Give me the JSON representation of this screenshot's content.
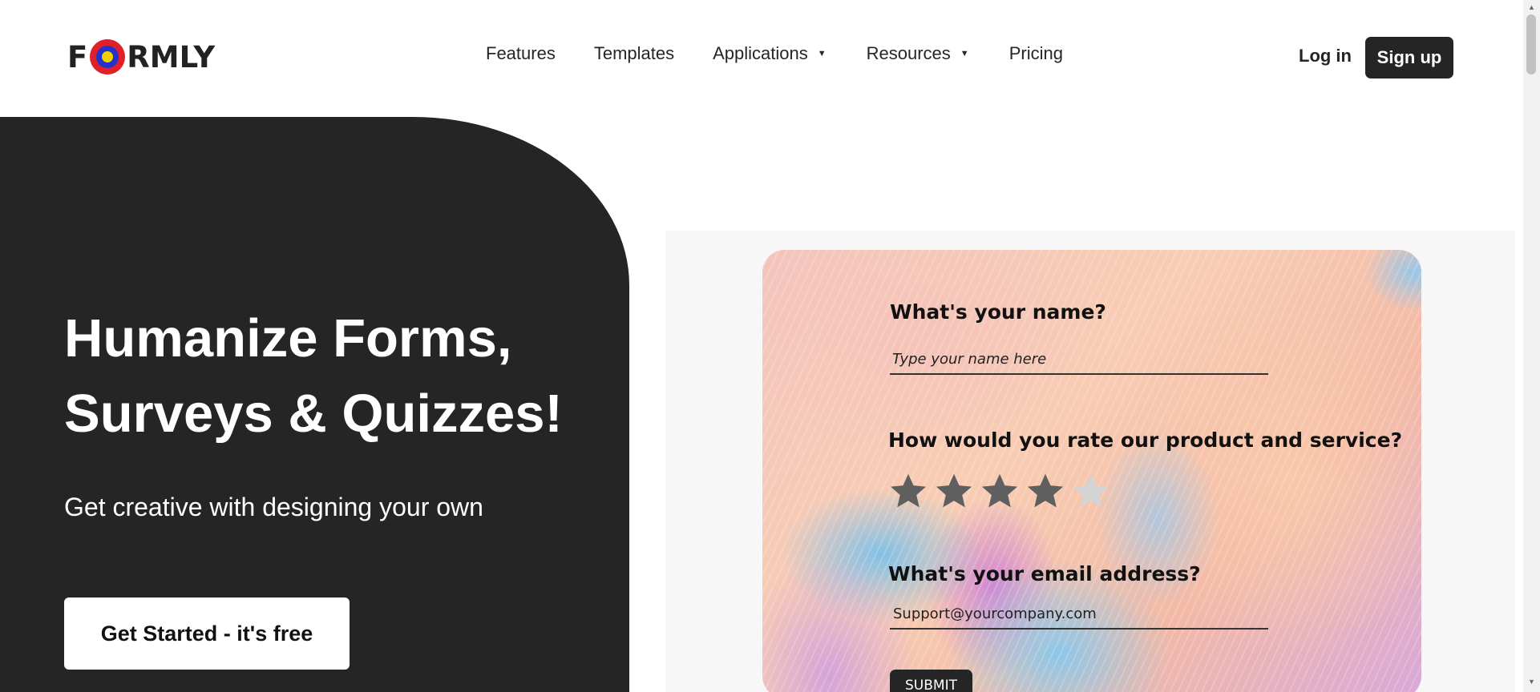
{
  "header": {
    "logo": {
      "before": "F",
      "after": "RMLY"
    },
    "nav": [
      {
        "label": "Features",
        "has_dropdown": false
      },
      {
        "label": "Templates",
        "has_dropdown": false
      },
      {
        "label": "Applications",
        "has_dropdown": true
      },
      {
        "label": "Resources",
        "has_dropdown": true
      },
      {
        "label": "Pricing",
        "has_dropdown": false
      }
    ],
    "dropdown_caret": "▼",
    "login_label": "Log in",
    "signup_label": "Sign up"
  },
  "hero": {
    "title_line1": "Humanize Forms,",
    "title_line2": "Surveys & Quizzes!",
    "subtitle": "Get creative with designing your own",
    "cta_label": "Get Started - it's free"
  },
  "form_preview": {
    "q1": "What's your name?",
    "name_placeholder": "Type your name here",
    "q2": "How would you rate our product and service?",
    "rating": {
      "value": 4,
      "max": 5
    },
    "q3": "What's your email address?",
    "email_value": "Support@yourcompany.com",
    "submit_label": "SUBMIT"
  },
  "colors": {
    "dark": "#262526",
    "star_filled": "#5f5f5f",
    "star_empty": "#d4d4d4",
    "logo_ring_outer": "#e0202a",
    "logo_ring_mid": "#2233cc",
    "logo_ring_inner": "#f5d000"
  },
  "scrollbar": {
    "up": "▲",
    "down": "▼"
  }
}
